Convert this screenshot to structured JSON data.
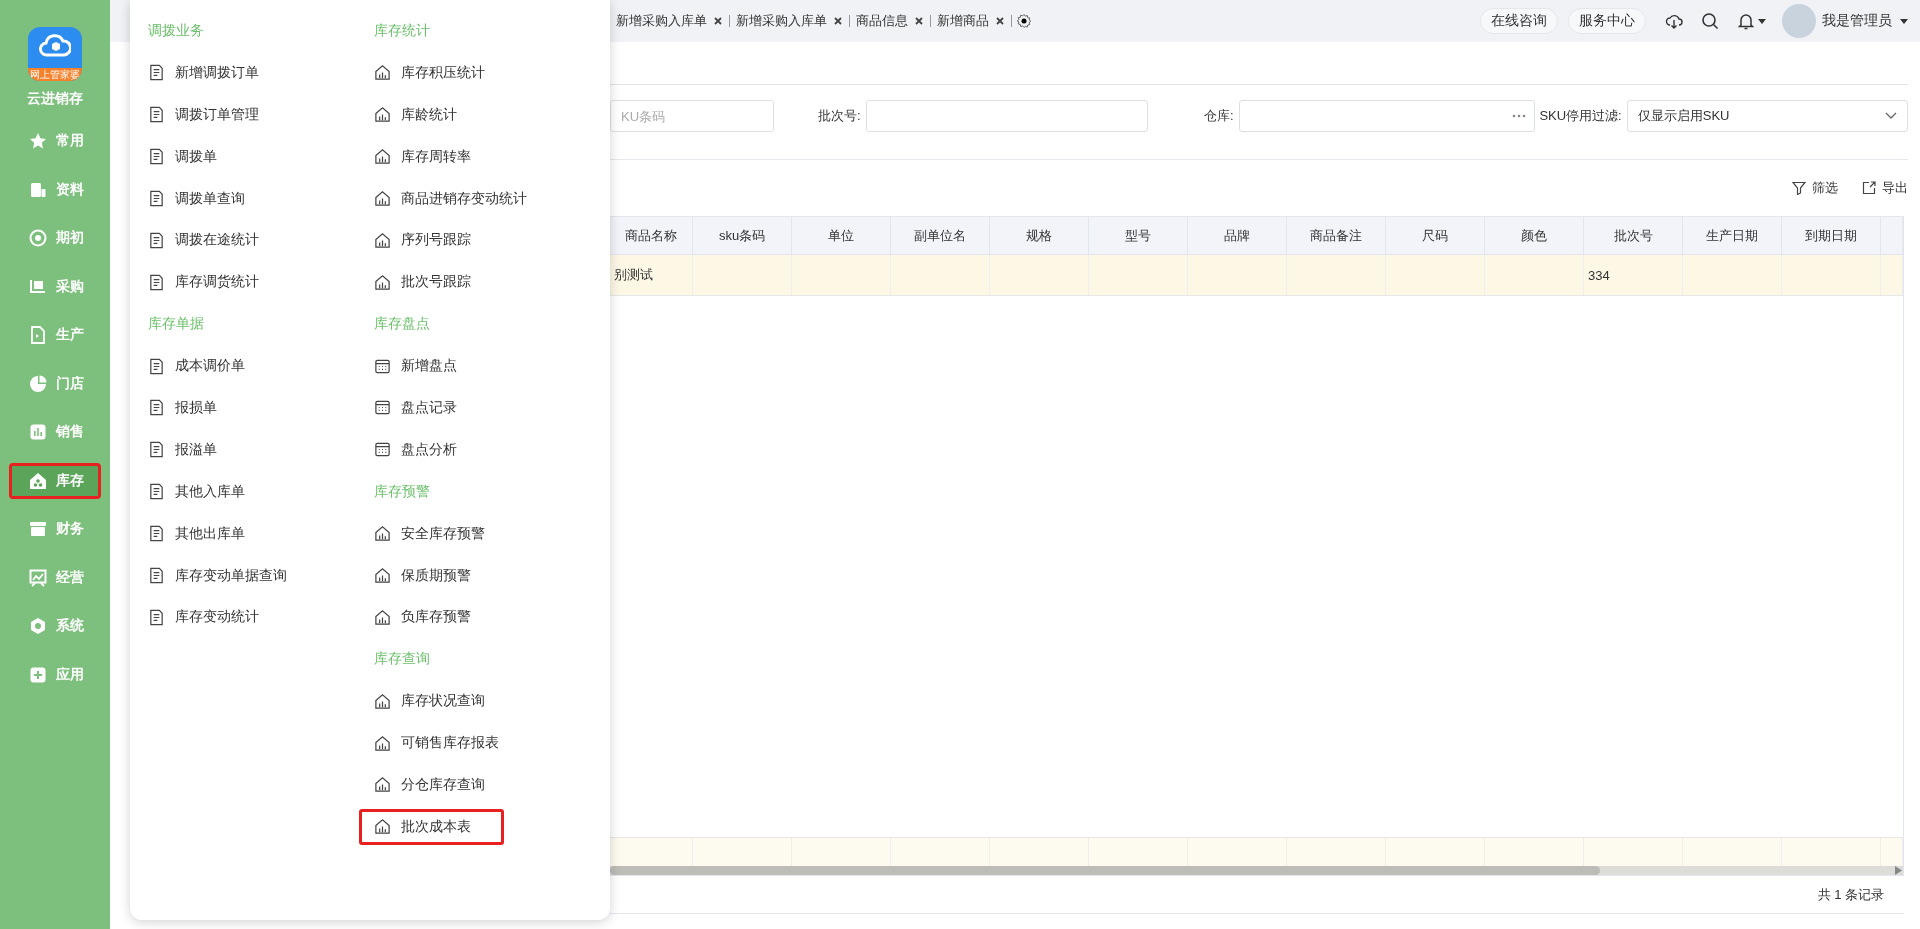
{
  "sidebar": {
    "logo_badge": "网上管家婆",
    "app_name": "云进销存",
    "items": [
      {
        "label": "常用",
        "selected": false,
        "annotated": false
      },
      {
        "label": "资料",
        "selected": false,
        "annotated": false
      },
      {
        "label": "期初",
        "selected": false,
        "annotated": false
      },
      {
        "label": "采购",
        "selected": false,
        "annotated": false
      },
      {
        "label": "生产",
        "selected": false,
        "annotated": false
      },
      {
        "label": "门店",
        "selected": false,
        "annotated": false
      },
      {
        "label": "销售",
        "selected": false,
        "annotated": false
      },
      {
        "label": "库存",
        "selected": true,
        "annotated": true
      },
      {
        "label": "财务",
        "selected": false,
        "annotated": false
      },
      {
        "label": "经营",
        "selected": false,
        "annotated": false
      },
      {
        "label": "系统",
        "selected": false,
        "annotated": false
      },
      {
        "label": "应用",
        "selected": false,
        "annotated": false
      }
    ]
  },
  "menu": {
    "columns": [
      {
        "groups": [
          {
            "heading": "调拨业务",
            "items": [
              {
                "label": "新增调拨订单",
                "annotated": false
              },
              {
                "label": "调拨订单管理",
                "annotated": false
              },
              {
                "label": "调拨单",
                "annotated": false
              },
              {
                "label": "调拨单查询",
                "annotated": false
              },
              {
                "label": "调拨在途统计",
                "annotated": false
              },
              {
                "label": "库存调货统计",
                "annotated": false
              }
            ]
          },
          {
            "heading": "库存单据",
            "items": [
              {
                "label": "成本调价单",
                "annotated": false
              },
              {
                "label": "报损单",
                "annotated": false
              },
              {
                "label": "报溢单",
                "annotated": false
              },
              {
                "label": "其他入库单",
                "annotated": false
              },
              {
                "label": "其他出库单",
                "annotated": false
              },
              {
                "label": "库存变动单据查询",
                "annotated": false
              },
              {
                "label": "库存变动统计",
                "annotated": false
              }
            ]
          }
        ]
      },
      {
        "groups": [
          {
            "heading": "库存统计",
            "items": [
              {
                "label": "库存积压统计",
                "annotated": false
              },
              {
                "label": "库龄统计",
                "annotated": false
              },
              {
                "label": "库存周转率",
                "annotated": false
              },
              {
                "label": "商品进销存变动统计",
                "annotated": false
              },
              {
                "label": "序列号跟踪",
                "annotated": false
              },
              {
                "label": "批次号跟踪",
                "annotated": false
              }
            ]
          },
          {
            "heading": "库存盘点",
            "items": [
              {
                "label": "新增盘点",
                "annotated": false
              },
              {
                "label": "盘点记录",
                "annotated": false
              },
              {
                "label": "盘点分析",
                "annotated": false
              }
            ]
          },
          {
            "heading": "库存预警",
            "items": [
              {
                "label": "安全库存预警",
                "annotated": false
              },
              {
                "label": "保质期预警",
                "annotated": false
              },
              {
                "label": "负库存预警",
                "annotated": false
              }
            ]
          },
          {
            "heading": "库存查询",
            "items": [
              {
                "label": "库存状况查询",
                "annotated": false
              },
              {
                "label": "可销售库存报表",
                "annotated": false
              },
              {
                "label": "分仓库存查询",
                "annotated": false
              },
              {
                "label": "批次成本表",
                "annotated": true
              }
            ]
          }
        ]
      }
    ]
  },
  "top_bar": {
    "tabs": [
      {
        "label": "新增采购入库单"
      },
      {
        "label": "新增采购入库单"
      },
      {
        "label": "商品信息"
      },
      {
        "label": "新增商品"
      }
    ],
    "buttons": [
      "在线咨询",
      "服务中心"
    ],
    "user_name": "我是管理员"
  },
  "filters": {
    "sku_placeholder": "KU条码",
    "batch_label": "批次号:",
    "warehouse_label": "仓库:",
    "sku_filter_label": "SKU停用过滤:",
    "sku_filter_value": "仅显示启用SKU"
  },
  "toolbar": [
    "筛选",
    "导出"
  ],
  "table": {
    "columns": [
      "商品名称",
      "sku条码",
      "单位",
      "副单位名",
      "规格",
      "型号",
      "品牌",
      "商品备注",
      "尺码",
      "颜色",
      "批次号",
      "生产日期",
      "到期日期"
    ],
    "rows": [
      {
        "cells": [
          "别测试",
          null,
          null,
          null,
          null,
          null,
          null,
          null,
          null,
          null,
          "334",
          null,
          null
        ],
        "selected": true
      }
    ]
  },
  "footer": "共 1 条记录"
}
